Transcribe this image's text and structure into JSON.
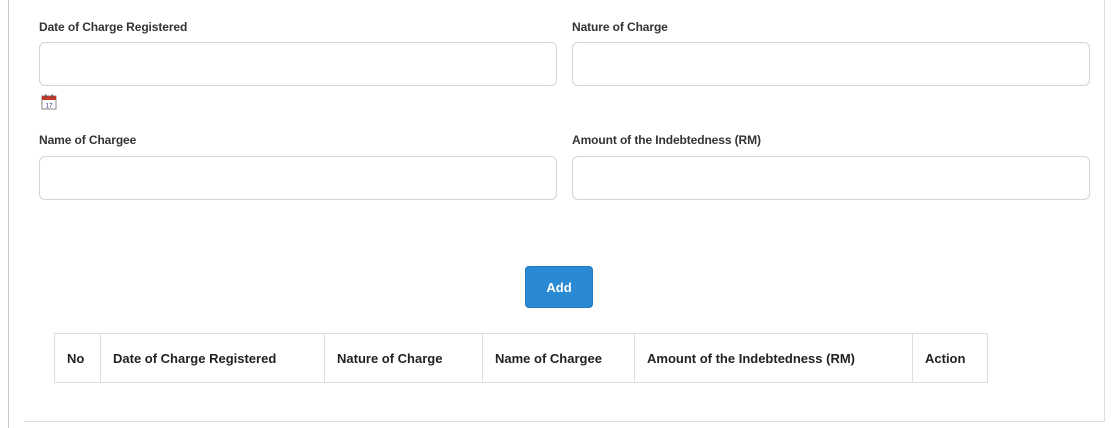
{
  "form": {
    "date_registered": {
      "label": "Date of Charge Registered",
      "value": ""
    },
    "nature_of_charge": {
      "label": "Nature of Charge",
      "value": ""
    },
    "name_of_chargee": {
      "label": "Name of Chargee",
      "value": ""
    },
    "amount_indebtedness": {
      "label": "Amount of the Indebtedness (RM)",
      "value": ""
    },
    "calendar_icon": "calendar-icon",
    "calendar_day": "17",
    "add_label": "Add"
  },
  "table": {
    "columns": [
      "No",
      "Date of Charge Registered",
      "Nature of Charge",
      "Name of Chargee",
      "Amount of the Indebtedness (RM)",
      "Action"
    ],
    "rows": []
  },
  "colors": {
    "accent": "#2a89d3",
    "calendar_top": "#c0392b"
  }
}
